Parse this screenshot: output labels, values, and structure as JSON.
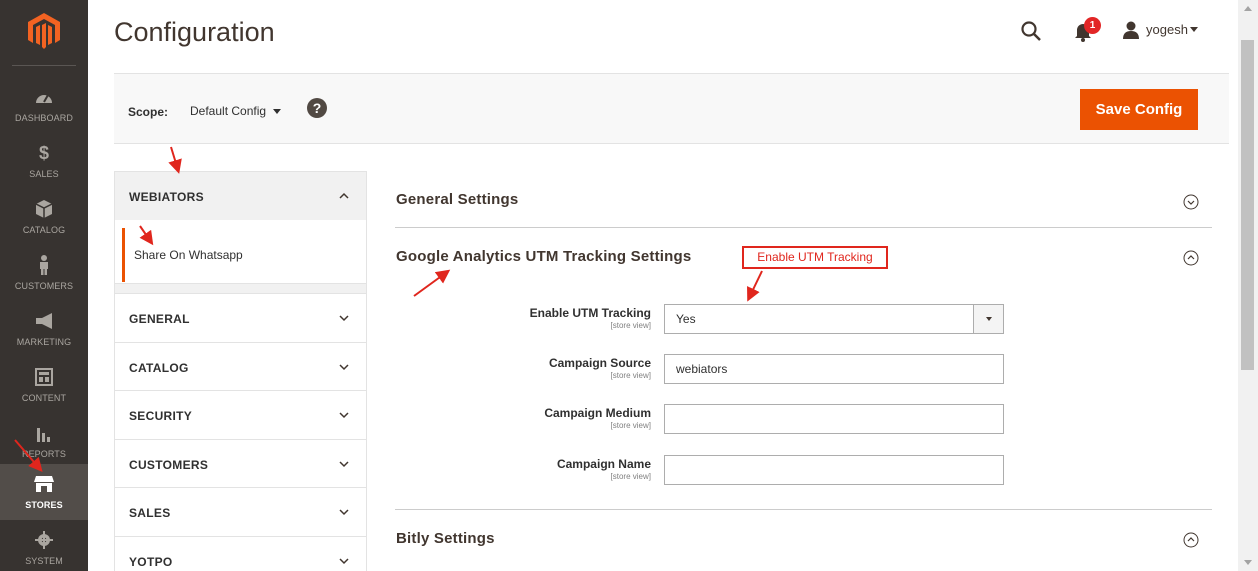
{
  "header": {
    "title": "Configuration",
    "notification_count": "1",
    "user_name": "yogesh"
  },
  "nav": {
    "items": [
      {
        "label": "DASHBOARD",
        "icon": "dashboard-icon"
      },
      {
        "label": "SALES",
        "icon": "dollar-icon"
      },
      {
        "label": "CATALOG",
        "icon": "box-icon"
      },
      {
        "label": "CUSTOMERS",
        "icon": "person-icon"
      },
      {
        "label": "MARKETING",
        "icon": "megaphone-icon"
      },
      {
        "label": "CONTENT",
        "icon": "layout-icon"
      },
      {
        "label": "REPORTS",
        "icon": "bar-chart-icon"
      },
      {
        "label": "STORES",
        "icon": "store-icon",
        "active": true
      },
      {
        "label": "SYSTEM",
        "icon": "gear-icon"
      }
    ]
  },
  "scope": {
    "label": "Scope:",
    "value": "Default Config",
    "help": "?",
    "save_label": "Save Config"
  },
  "tabs": {
    "expanded": {
      "label": "WEBIATORS",
      "sub_items": [
        "Share On Whatsapp"
      ]
    },
    "collapsed": [
      "GENERAL",
      "CATALOG",
      "SECURITY",
      "CUSTOMERS",
      "SALES",
      "YOTPO"
    ]
  },
  "sections": {
    "general": {
      "title": "General Settings"
    },
    "utm": {
      "title": "Google Analytics UTM Tracking Settings",
      "fields": [
        {
          "label": "Enable UTM Tracking",
          "scope": "[store view]",
          "value": "Yes",
          "type": "select"
        },
        {
          "label": "Campaign Source",
          "scope": "[store view]",
          "value": "webiators",
          "type": "text"
        },
        {
          "label": "Campaign Medium",
          "scope": "[store view]",
          "value": "",
          "type": "text"
        },
        {
          "label": "Campaign Name",
          "scope": "[store view]",
          "value": "",
          "type": "text"
        }
      ]
    },
    "bitly": {
      "title": "Bitly Settings"
    }
  },
  "annotation": {
    "callout": "Enable UTM Tracking",
    "color": "#e0261d"
  },
  "colors": {
    "accent": "#eb5202",
    "nav_bg": "#373330",
    "badge": "#e22626"
  }
}
